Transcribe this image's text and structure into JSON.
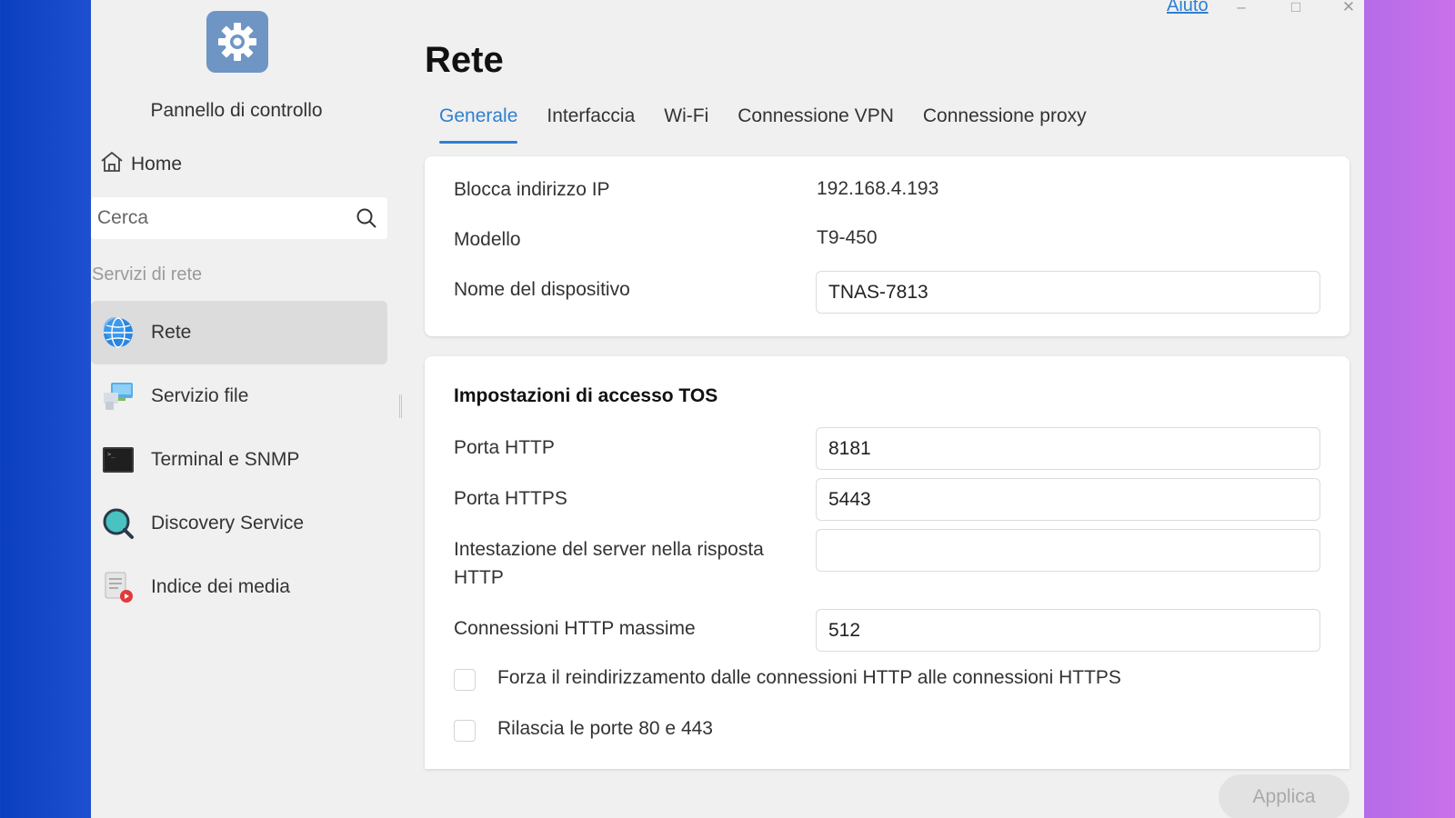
{
  "window": {
    "help_label": "Aiuto",
    "controls": {
      "minimize": "–",
      "maximize": "□",
      "close": "✕"
    }
  },
  "sidebar": {
    "app_icon": "gear-icon",
    "app_title": "Pannello di controllo",
    "home_label": "Home",
    "search_placeholder": "Cerca",
    "section_label": "Servizi di rete",
    "items": [
      {
        "label": "Rete",
        "icon": "globe-icon",
        "active": true
      },
      {
        "label": "Servizio file",
        "icon": "file-service-icon",
        "active": false
      },
      {
        "label": "Terminal e SNMP",
        "icon": "terminal-icon",
        "active": false
      },
      {
        "label": "Discovery Service",
        "icon": "discovery-icon",
        "active": false
      },
      {
        "label": "Indice dei media",
        "icon": "media-index-icon",
        "active": false
      }
    ]
  },
  "main": {
    "title": "Rete",
    "tabs": [
      {
        "label": "Generale",
        "active": true
      },
      {
        "label": "Interfaccia",
        "active": false
      },
      {
        "label": "Wi-Fi",
        "active": false
      },
      {
        "label": "Connessione VPN",
        "active": false
      },
      {
        "label": "Connessione proxy",
        "active": false
      }
    ],
    "info": {
      "ip_label": "Blocca indirizzo IP",
      "ip_value": "192.168.4.193",
      "model_label": "Modello",
      "model_value": "T9-450",
      "device_name_label": "Nome del dispositivo",
      "device_name_value": "TNAS-7813"
    },
    "access": {
      "heading": "Impostazioni di accesso TOS",
      "http_port_label": "Porta HTTP",
      "http_port_value": "8181",
      "https_port_label": "Porta HTTPS",
      "https_port_value": "5443",
      "server_header_label_line1": "Intestazione del server nella risposta",
      "server_header_label_line2": "HTTP",
      "server_header_value": "",
      "max_conn_label": "Connessioni HTTP massime",
      "max_conn_value": "512",
      "force_redirect_label": "Forza il reindirizzamento dalle connessioni HTTP alle connessioni HTTPS",
      "force_redirect_checked": false,
      "release_ports_label": "Rilascia le porte 80 e 443",
      "release_ports_checked": false
    },
    "apply_label": "Applica"
  },
  "colors": {
    "accent": "#2f7fd1",
    "window_bg": "#f0f0f0",
    "active_nav_bg": "#dcdcdc"
  }
}
